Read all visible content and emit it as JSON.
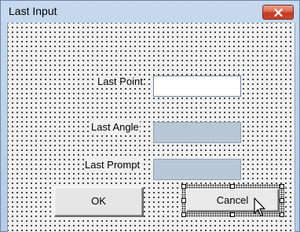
{
  "window": {
    "title": "Last Input"
  },
  "labels": {
    "last_point": "Last Point",
    "last_angle": "Last Angle",
    "last_prompt": "Last Prompt"
  },
  "fields": {
    "last_point_value": "",
    "last_angle_value": "",
    "last_prompt_value": ""
  },
  "buttons": {
    "ok": "OK",
    "cancel": "Cancel"
  },
  "icons": {
    "close": "close-icon",
    "cursor": "mouse-pointer-icon"
  },
  "colors": {
    "close_button": "#c7462c",
    "disabled_field": "#b9c7d6",
    "form_background": "#f0f0f0"
  }
}
